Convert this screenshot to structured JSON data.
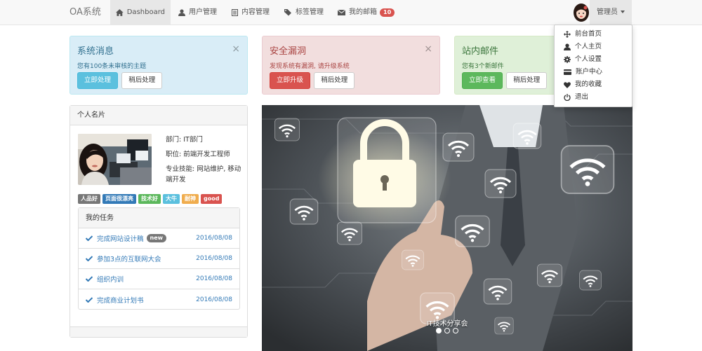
{
  "navbar": {
    "brand": "OA系统",
    "items": [
      {
        "label": "Dashboard",
        "icon": "home-icon"
      },
      {
        "label": "用户管理",
        "icon": "user-icon"
      },
      {
        "label": "内容管理",
        "icon": "list-icon"
      },
      {
        "label": "标签管理",
        "icon": "tags-icon"
      },
      {
        "label": "我的邮箱",
        "icon": "envelope-icon",
        "badge": "10"
      }
    ],
    "user_label": "管理员"
  },
  "dropdown": {
    "items": [
      {
        "label": "前台首页",
        "icon": "move-icon"
      },
      {
        "label": "个人主页",
        "icon": "user-icon"
      },
      {
        "label": "个人设置",
        "icon": "cog-icon"
      },
      {
        "label": "账户中心",
        "icon": "credit-card-icon"
      },
      {
        "label": "我的收藏",
        "icon": "heart-icon"
      },
      {
        "label": "退出",
        "icon": "power-icon"
      }
    ]
  },
  "alerts": [
    {
      "title": "系统消息",
      "text": "您有100条未审核的主题",
      "primary": "立即处理",
      "secondary": "稍后处理",
      "close": "×"
    },
    {
      "title": "安全漏洞",
      "text": "发现系统有漏洞, 请升级系统",
      "primary": "立即升级",
      "secondary": "稍后处理",
      "close": "×"
    },
    {
      "title": "站内邮件",
      "text": "您有3个新邮件",
      "primary": "立即查看",
      "secondary": "稍后处理",
      "close": "×"
    }
  ],
  "profile": {
    "heading": "个人名片",
    "department": "部门: IT部门",
    "position": "职位: 前端开发工程师",
    "skills": "专业技能: 网站维护, 移动端开发",
    "tags": [
      {
        "label": "人品好",
        "color": "#777777"
      },
      {
        "label": "页面很漂亮",
        "color": "#337ab7"
      },
      {
        "label": "技术好",
        "color": "#5cb85c"
      },
      {
        "label": "大牛",
        "color": "#5bc0de"
      },
      {
        "label": "耐神",
        "color": "#f0ad4e"
      },
      {
        "label": "good",
        "color": "#d9534f"
      }
    ]
  },
  "tasks": {
    "heading": "我的任务",
    "items": [
      {
        "label": "完成网站设计稿",
        "badge": "new",
        "date": "2016/08/08"
      },
      {
        "label": "参加3点的互联网大会",
        "date": "2016/08/08"
      },
      {
        "label": "组织内训",
        "date": "2016/08/08"
      },
      {
        "label": "完成商业计划书",
        "date": "2016/08/08"
      }
    ]
  },
  "carousel": {
    "caption": "IT技术分享会",
    "slides": 3,
    "active": 0
  }
}
